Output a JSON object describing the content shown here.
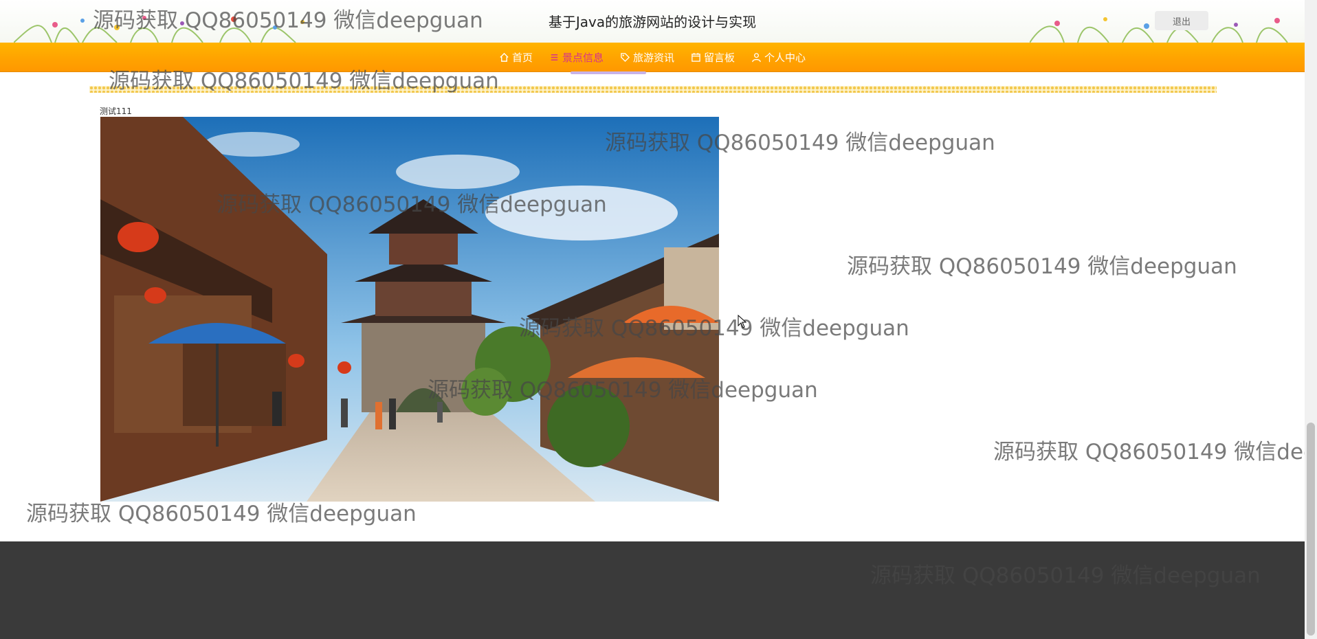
{
  "header": {
    "site_title": "基于Java的旅游网站的设计与实现",
    "logout_label": "退出"
  },
  "nav": {
    "items": [
      {
        "label": "首页",
        "icon": "home-icon",
        "active": false
      },
      {
        "label": "景点信息",
        "icon": "list-icon",
        "active": true
      },
      {
        "label": "旅游资讯",
        "icon": "tag-icon",
        "active": false
      },
      {
        "label": "留言板",
        "icon": "calendar-icon",
        "active": false
      },
      {
        "label": "个人中心",
        "icon": "user-icon",
        "active": false
      }
    ]
  },
  "content": {
    "caption": "测试111",
    "image_icon": "scene-photo"
  },
  "watermark": {
    "text": "源码获取 QQ86050149 微信deepguan"
  },
  "colors": {
    "nav_bar": "#ffa200",
    "nav_active": "#d6338a",
    "footer": "#3a3a3a",
    "divider": "#f2c84d"
  }
}
